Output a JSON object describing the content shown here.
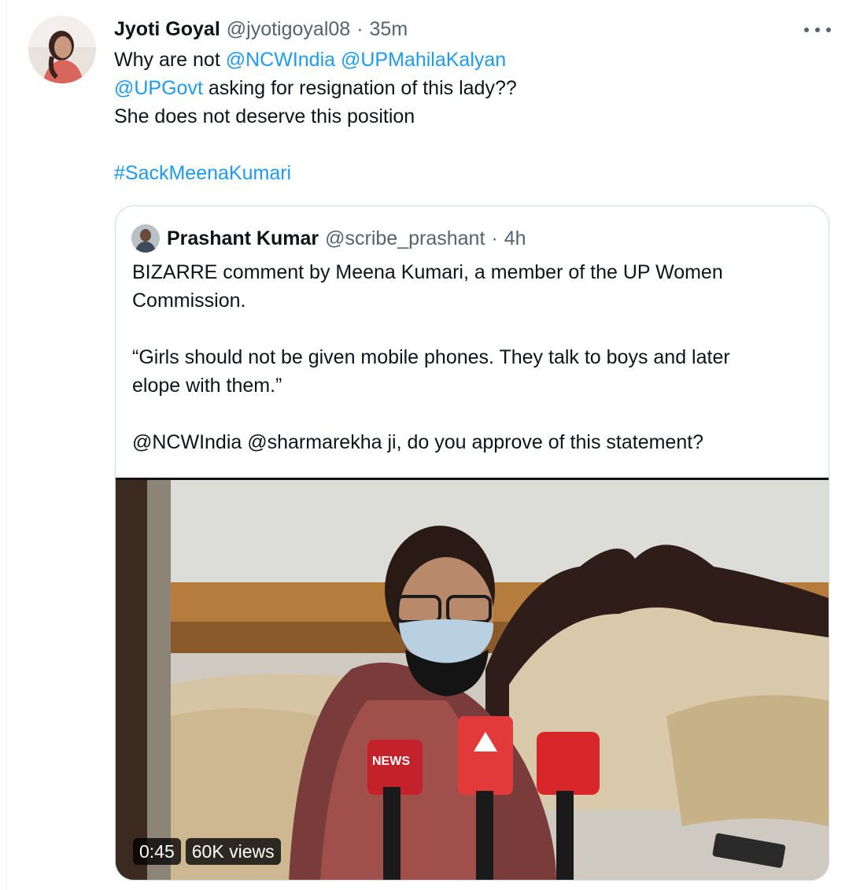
{
  "tweet": {
    "author_name": "Jyoti Goyal",
    "author_handle": "@jyotigoyal08",
    "separator": "·",
    "time": "35m",
    "line1_prefix": "Why are not ",
    "mention1": "@NCWIndia",
    "mention2": "@UPMahilaKalyan",
    "mention3": "@UPGovt",
    "line2_suffix": " asking for resignation of this lady??",
    "line3": "She does not deserve this position",
    "hashtag": "#SackMeenaKumari"
  },
  "quote": {
    "author_name": "Prashant Kumar",
    "author_handle": "@scribe_prashant",
    "separator": "·",
    "time": "4h",
    "line1": "BIZARRE comment by Meena Kumari, a member of the UP Women",
    "line2": "Commission.",
    "line3": "“Girls should not be given mobile phones. They talk to boys and later",
    "line4": "elope with them.”",
    "line5": "@NCWIndia @sharmarekha ji, do you approve of this statement?",
    "video": {
      "duration": "0:45",
      "views": "60K views",
      "mic_label": "NEWS"
    }
  },
  "icons": {
    "more": "more-horizontal-icon"
  },
  "colors": {
    "link": "#1d9bf0",
    "secondary_text": "#536471",
    "border": "#cfd9de"
  }
}
